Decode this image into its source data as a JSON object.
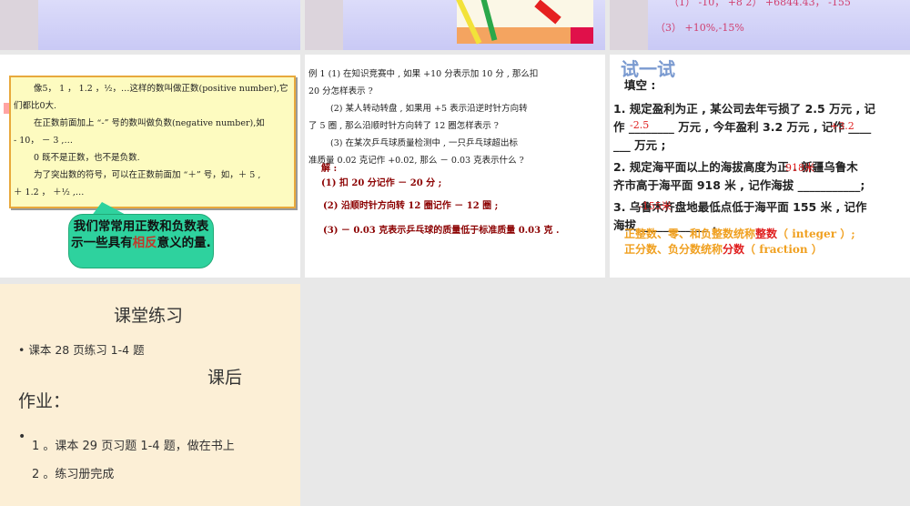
{
  "slides": [
    {
      "id": "partial-1"
    },
    {
      "id": "partial-2",
      "image": "pens-drawing"
    },
    {
      "id": "partial-3",
      "lines": [
        "（1） -10， +8 2） +6844.43， -155",
        "（3） +10%,-15%"
      ]
    },
    {
      "id": "positive-negative",
      "paragraphs": [
        "像5， 1 ， 1.2 ，½，…这样的数叫做正数(positive  number),它",
        "们都比0大.",
        "在正数前面加上 “-” 号的数叫做负数(negative  number),如",
        "- 10， － 3 ,…",
        "0 既不是正数，也不是负数.",
        "为了突出数的符号，可以在正数前面加 “＋” 号，如，＋ 5 ,",
        "＋ 1.2 ， ＋½  ,…"
      ],
      "callout_before": "我们常常用正数和负数表示一些具有",
      "callout_highlight": "相反",
      "callout_after": "意义的量."
    },
    {
      "id": "example-1",
      "lines": [
        "例 1  (1) 在知识竞赛中 , 如果 +10 分表示加 10 分 , 那么扣",
        "20 分怎样表示 ?",
        "(2) 某人转动转盘 , 如果用 +5 表示沿逆时针方向转",
        "了 5 圈 , 那么沿顺时针方向转了 12 圈怎样表示 ?",
        "(3) 在某次乒乓球质量检测中 , 一只乒乓球超出标",
        "准质量 0.02 克记作 +0.02, 那么 － 0.03 克表示什么 ?"
      ],
      "answer_label": "解  :",
      "answers": [
        "(1) 扣 20 分记作 － 20 分 ;",
        "(2) 沿顺时针方向转 12 圈记作 － 12 圈 ;",
        "(3) － 0.03 克表示乒乓球的质量低于标准质量 0.03 克 ."
      ]
    },
    {
      "id": "try-it",
      "title": "试一试",
      "subtitle": "填空 :",
      "q1": [
        "1. 规定盈利为正 , 某公司去年亏损了 2.5 万元 , 记",
        "作 ________ 万元 , 今年盈利 3.2 万元 , 记作 ____",
        "___ 万元 ;"
      ],
      "q2": [
        "2. 规定海平面以上的海拔高度为正 . 新疆乌鲁木",
        "齐市高于海平面 918 米 , 记作海拔 ___________;"
      ],
      "q3": [
        "3. 乌鲁木齐盘地最低点低于海平面 155 米 , 记作",
        "海拔 ____________ ."
      ],
      "fills": [
        "-2.5",
        "+3.2",
        "918米",
        "-155米"
      ],
      "summary1_a": "正整数、零、和负整数统称",
      "summary1_b": "整数",
      "summary1_c": "（ integer ）;",
      "summary2_a": "正分数、负分数统称",
      "summary2_b": "分数",
      "summary2_c": "（ fraction ）"
    },
    {
      "id": "homework",
      "title": "课堂练习",
      "bullet1": "课本 28 页练习 1-4 题",
      "heading_a": "课后",
      "heading_b": "作业：",
      "item1": "1 。课本 29 页习题 1-4 题，做在书上",
      "item2": "2 。练习册完成"
    }
  ]
}
